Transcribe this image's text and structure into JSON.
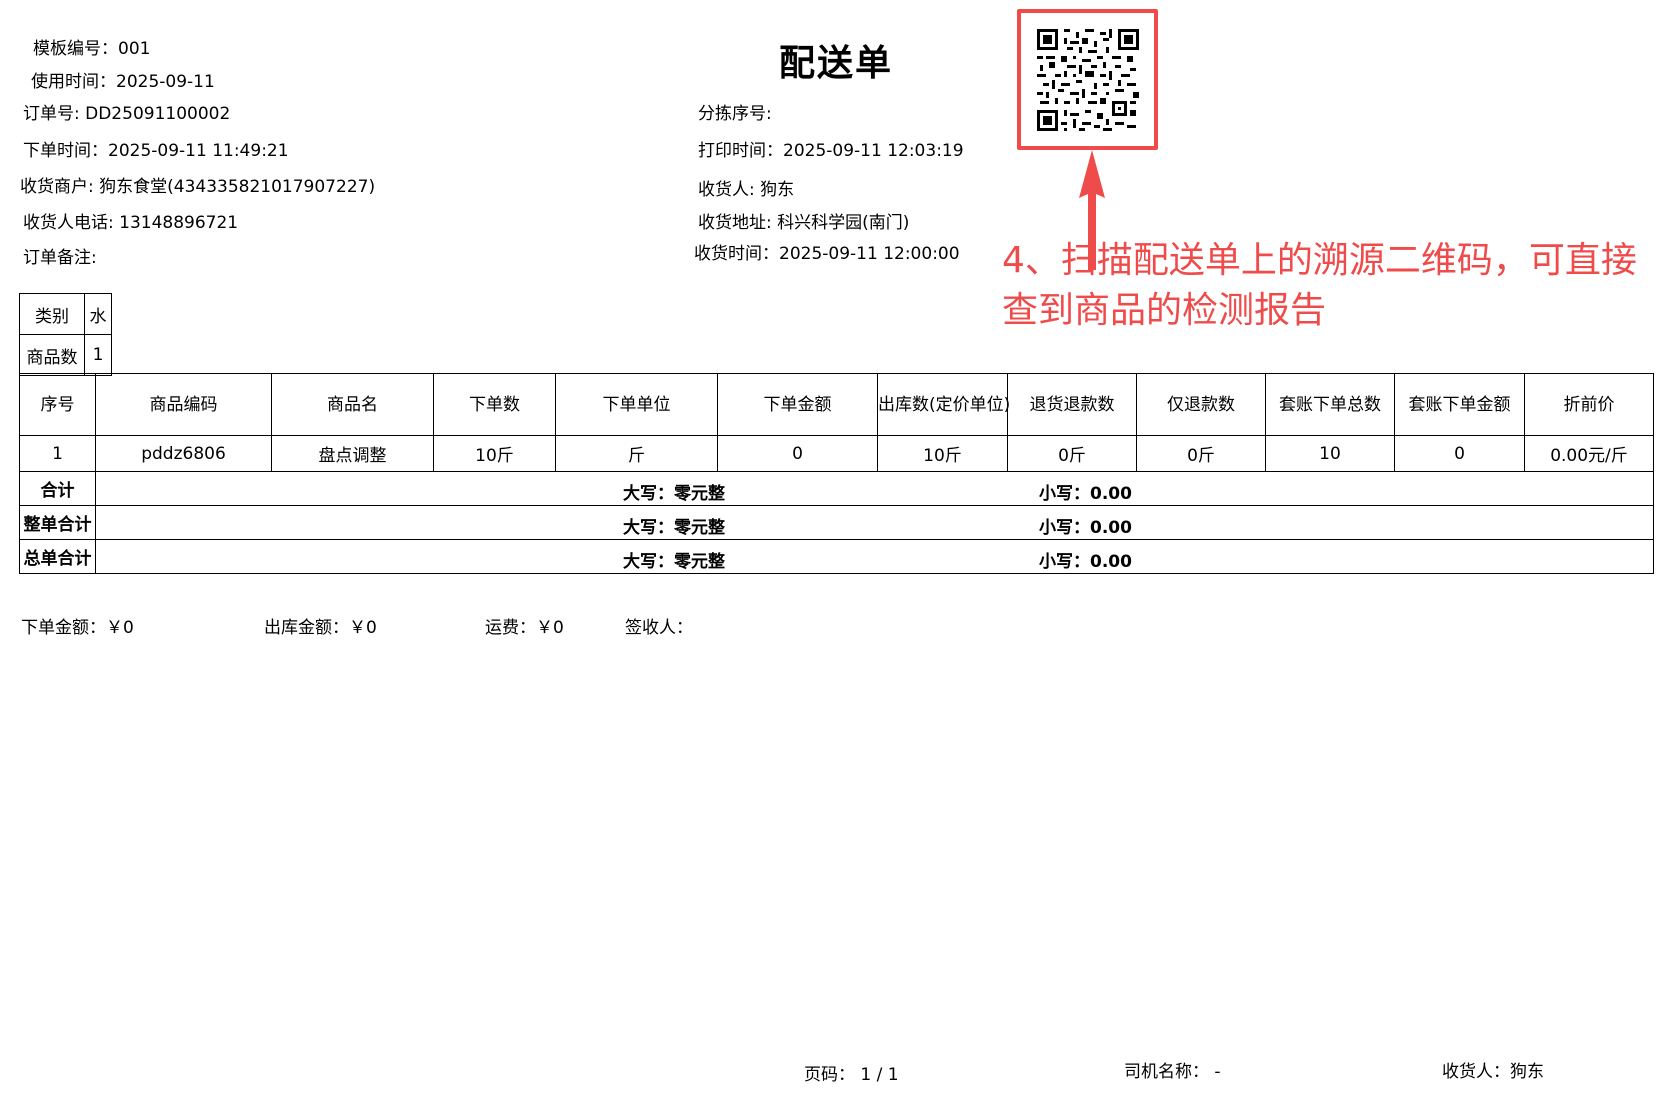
{
  "header": {
    "template_no": "模板编号：001",
    "use_time": "使用时间：2025-09-11",
    "title": "配送单",
    "order_no": "订单号: DD25091100002",
    "sort_no": "分拣序号:",
    "order_time": "下单时间：2025-09-11 11:49:21",
    "print_time": "打印时间：2025-09-11 12:03:19",
    "merchant": "收货商户: 狗东食堂(434335821017907227)",
    "receiver": "收货人: 狗东",
    "phone": "收货人电话: 13148896721",
    "address": "收货地址: 科兴科学园(南门)",
    "remark": "订单备注:",
    "receive_time": "收货时间：2025-09-11 12:00:00"
  },
  "annotation": {
    "text": "4、扫描配送单上的溯源二维码，可直接查到商品的检测报告",
    "color": "#ef4b4b"
  },
  "category_table": {
    "row1": [
      "类别",
      "水"
    ],
    "row2": [
      "商品数",
      "1"
    ]
  },
  "items_table": {
    "columns": [
      "序号",
      "商品编码",
      "商品名",
      "下单数",
      "下单单位",
      "下单金额",
      "出库数(定价单位)",
      "退货退款数",
      "仅退款数",
      "套账下单总数",
      "套账下单金额",
      "折前价"
    ],
    "rows": [
      [
        "1",
        "pddz6806",
        "盘点调整",
        "10斤",
        "斤",
        "0",
        "10斤",
        "0斤",
        "0斤",
        "10",
        "0",
        "0.00元/斤"
      ]
    ],
    "summaries": [
      {
        "label": "合计",
        "upper": "大写：零元整",
        "lower": "小写：0.00"
      },
      {
        "label": "整单合计",
        "upper": "大写：零元整",
        "lower": "小写：0.00"
      },
      {
        "label": "总单合计",
        "upper": "大写：零元整",
        "lower": "小写：0.00"
      }
    ]
  },
  "footer_amounts": {
    "order_amount": "下单金额：￥0",
    "out_amount": "出库金额：￥0",
    "freight": "运费：￥0",
    "signer": "签收人："
  },
  "page_footer": {
    "page": "页码：  1 / 1",
    "driver": "司机名称：  -",
    "receiver": "收货人：狗东"
  }
}
